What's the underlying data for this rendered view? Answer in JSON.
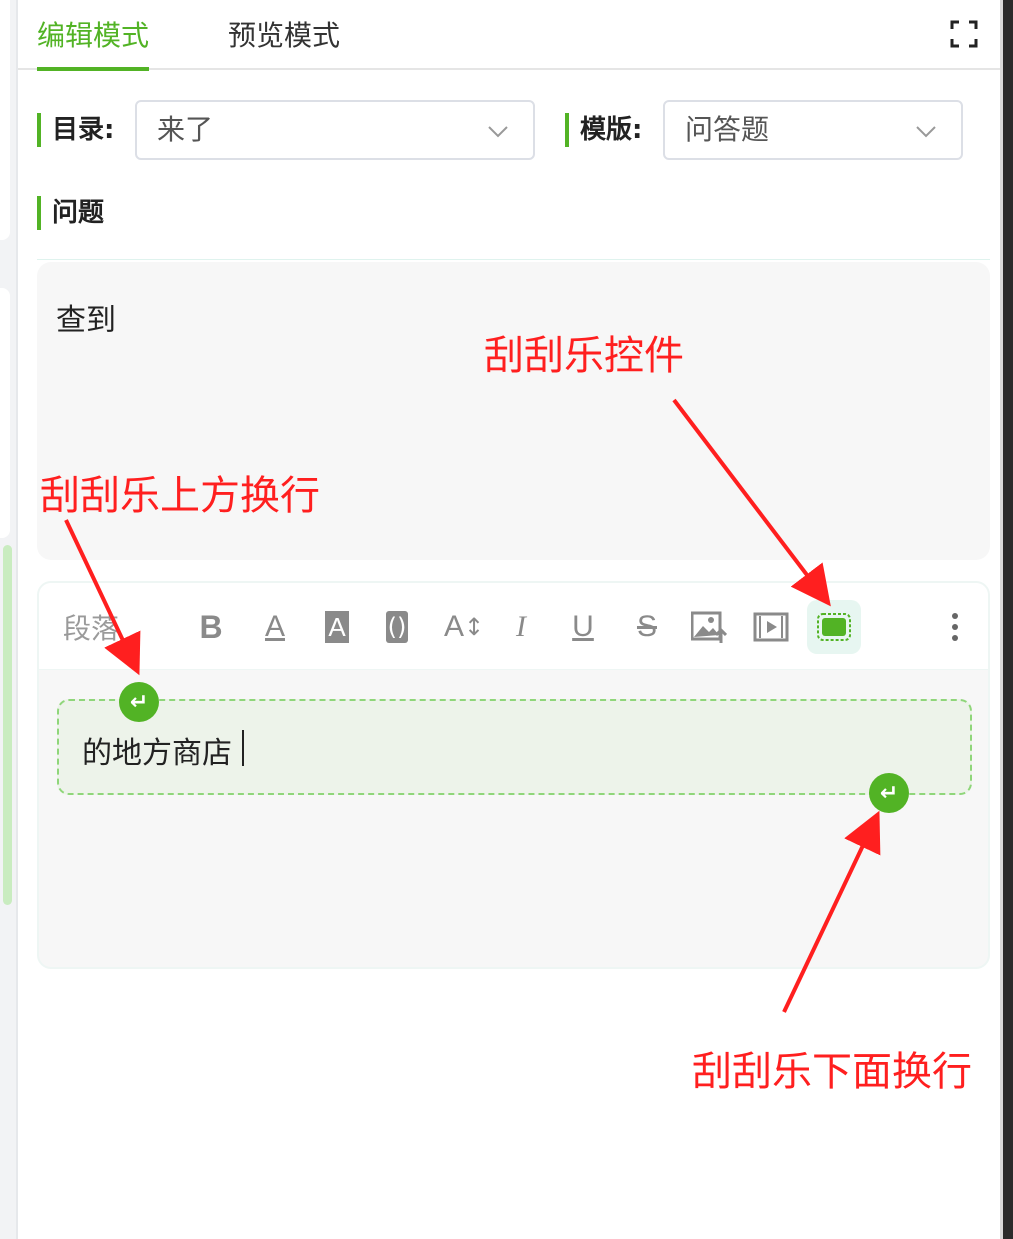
{
  "tabs": {
    "edit": "编辑模式",
    "preview": "预览模式"
  },
  "form": {
    "catalog_label": "目录:",
    "catalog_value": "来了",
    "template_label": "模版:",
    "template_value": "问答题",
    "question_label": "问题"
  },
  "question": {
    "text": "查到"
  },
  "toolbar": {
    "paragraph": "段落",
    "icons": [
      "bold-icon",
      "font-color-icon",
      "background-color-icon",
      "bracket-icon",
      "font-size-icon",
      "italic-icon",
      "underline-icon",
      "strikethrough-icon",
      "image-upload-icon",
      "video-icon",
      "scratch-card-icon",
      "more-icon"
    ]
  },
  "editor": {
    "scratch_text": "的地方商店",
    "enter_symbol": "↵"
  },
  "annotations": {
    "scratch_control": "刮刮乐控件",
    "above_newline": "刮刮乐上方换行",
    "below_newline": "刮刮乐下面换行"
  },
  "colors": {
    "accent": "#52b325",
    "annotation": "#ff1f1f"
  }
}
